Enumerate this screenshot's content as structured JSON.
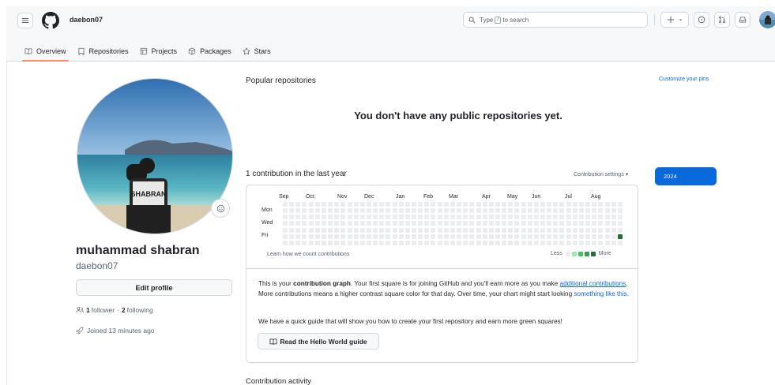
{
  "header": {
    "username": "daebon07",
    "search_text": "Type",
    "search_kbd": "/",
    "search_suffix": "to search"
  },
  "tabs": [
    {
      "label": "Overview",
      "icon": "book-icon",
      "active": true
    },
    {
      "label": "Repositories",
      "icon": "repo-icon",
      "active": false
    },
    {
      "label": "Projects",
      "icon": "table-icon",
      "active": false
    },
    {
      "label": "Packages",
      "icon": "package-icon",
      "active": false
    },
    {
      "label": "Stars",
      "icon": "star-icon",
      "active": false
    }
  ],
  "profile": {
    "full_name": "muhammad shabran",
    "login": "daebon07",
    "edit_label": "Edit profile",
    "followers_count": "1",
    "followers_label": "follower",
    "dot": "·",
    "following_count": "2",
    "following_label": "following",
    "joined": "Joined 13 minutes ago",
    "shirt_text": "SHABRAN"
  },
  "popular": {
    "title": "Popular repositories",
    "customize": "Customize your pins",
    "empty": "You don't have any public repositories yet."
  },
  "contributions": {
    "title": "1 contribution in the last year",
    "settings": "Contribution settings ▾",
    "year": "2024",
    "months": [
      "Sep",
      "Oct",
      "Nov",
      "Dec",
      "Jan",
      "Feb",
      "Mar",
      "Apr",
      "May",
      "Jun",
      "Jul",
      "Aug"
    ],
    "days": [
      "Mon",
      "Wed",
      "Fri"
    ],
    "learn": "Learn how we count contributions",
    "less": "Less",
    "more": "More",
    "colors": [
      "#ebedf0",
      "#9be9a8",
      "#40c463",
      "#30a14e",
      "#216e39"
    ],
    "weeks": 53,
    "active_cell": {
      "week": 52,
      "day": 5,
      "level": 4
    }
  },
  "info": {
    "p1_a": "This is your ",
    "p1_b": "contribution graph",
    "p1_c": ". Your first square is for joining GitHub and you'll earn more as you make ",
    "p1_link1": "additional contributions",
    "p1_d": ". More contributions means a higher contrast square color for that day. Over time, your chart might start looking ",
    "p1_link2": "something like this",
    "p1_e": ".",
    "p2": "We have a quick guide that will show you how to create your first repository and earn more green squares!",
    "guide_button": "Read the Hello World guide"
  },
  "activity": {
    "title": "Contribution activity"
  }
}
